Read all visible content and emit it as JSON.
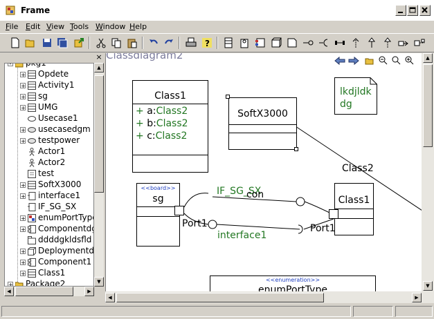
{
  "window": {
    "title": "Frame"
  },
  "menu": [
    {
      "label": "File",
      "ul": "F",
      "rest": "ile"
    },
    {
      "label": "Edit",
      "ul": "E",
      "rest": "dit"
    },
    {
      "label": "View",
      "ul": "V",
      "rest": "iew"
    },
    {
      "label": "Tools",
      "ul": "T",
      "rest": "ools"
    },
    {
      "label": "Window",
      "ul": "W",
      "rest": "indow"
    },
    {
      "label": "Help",
      "ul": "H",
      "rest": "elp"
    }
  ],
  "toolbar_icons": [
    "new-icon",
    "open-icon",
    "save-icon",
    "save-all-icon",
    "export-icon",
    "cut-icon",
    "copy-icon",
    "paste-icon",
    "undo-icon",
    "redo-icon",
    "print-icon",
    "help-icon",
    "class-tool-icon",
    "interface-tool-icon",
    "component-tool-icon",
    "node-tool-icon",
    "note-tool-icon",
    "lollipop-tool-icon",
    "socket-tool-icon",
    "connector-tool-icon",
    "dependency-tool-icon",
    "generalization-tool-icon",
    "realization-tool-icon",
    "association-tool-icon",
    "note-link-tool-icon"
  ],
  "tree": {
    "items": [
      {
        "label": "pkg1",
        "icon": "folder-icon",
        "expand": "-",
        "indent": 0
      },
      {
        "label": "Opdete",
        "icon": "class-icon",
        "expand": "+",
        "indent": 1
      },
      {
        "label": "Activity1",
        "icon": "class-icon",
        "expand": "+",
        "indent": 1
      },
      {
        "label": "sg",
        "icon": "class-icon",
        "expand": "+",
        "indent": 1
      },
      {
        "label": "UMG",
        "icon": "class-icon",
        "expand": "+",
        "indent": 1
      },
      {
        "label": "Usecase1",
        "icon": "usecase-icon",
        "expand": "",
        "indent": 1
      },
      {
        "label": "usecasedgm",
        "icon": "usecase-diagram-icon",
        "expand": "+",
        "indent": 1
      },
      {
        "label": "testpower",
        "icon": "usecase-diagram-icon",
        "expand": "+",
        "indent": 1
      },
      {
        "label": "Actor1",
        "icon": "actor-icon",
        "expand": "",
        "indent": 1
      },
      {
        "label": "Actor2",
        "icon": "actor-icon",
        "expand": "",
        "indent": 1
      },
      {
        "label": "test",
        "icon": "diagram-icon",
        "expand": "",
        "indent": 1
      },
      {
        "label": "SoftX3000",
        "icon": "class-icon",
        "expand": "+",
        "indent": 1
      },
      {
        "label": "interface1",
        "icon": "interface-icon",
        "expand": "+",
        "indent": 1
      },
      {
        "label": "IF_SG_SX",
        "icon": "interface-icon",
        "expand": "",
        "indent": 1
      },
      {
        "label": "enumPortType",
        "icon": "enum-icon",
        "expand": "+",
        "indent": 1
      },
      {
        "label": "Componentdgm",
        "icon": "component-icon",
        "expand": "+",
        "indent": 1
      },
      {
        "label": "ddddgkldsfld",
        "icon": "package-icon",
        "expand": "",
        "indent": 1
      },
      {
        "label": "Deploymentdgm",
        "icon": "deployment-icon",
        "expand": "+",
        "indent": 1
      },
      {
        "label": "Component1",
        "icon": "component-icon",
        "expand": "+",
        "indent": 1
      },
      {
        "label": "Class1",
        "icon": "class-icon",
        "expand": "+",
        "indent": 1
      },
      {
        "label": "Package2",
        "icon": "folder-icon",
        "expand": "+",
        "indent": 0
      }
    ]
  },
  "diagram": {
    "title": "Classdiagram2",
    "class1": {
      "name": "Class1",
      "attrs": [
        {
          "vis": "+",
          "name": "a:",
          "type": "Class2"
        },
        {
          "vis": "+",
          "name": "b:",
          "type": "Class2"
        },
        {
          "vis": "+",
          "name": "c:",
          "type": "Class2"
        }
      ]
    },
    "softx": {
      "name": "SoftX3000"
    },
    "note": {
      "line1": "lkdjldk",
      "line2": "dg"
    },
    "sg": {
      "stereotype": "<<board>>",
      "name": "sg"
    },
    "class1b": {
      "name": "Class1"
    },
    "enum": {
      "stereotype": "<<enumeration>>",
      "name": "enumPortType"
    },
    "labels": {
      "class2": "Class2",
      "if_sg_sx": "IF_SG_SX",
      "con": "con",
      "port1_left": "Port1",
      "port1_right": "Port1",
      "interface1": "interface1"
    }
  },
  "colors": {
    "accent_green": "#227722",
    "title_purple": "#7b7b9c"
  }
}
